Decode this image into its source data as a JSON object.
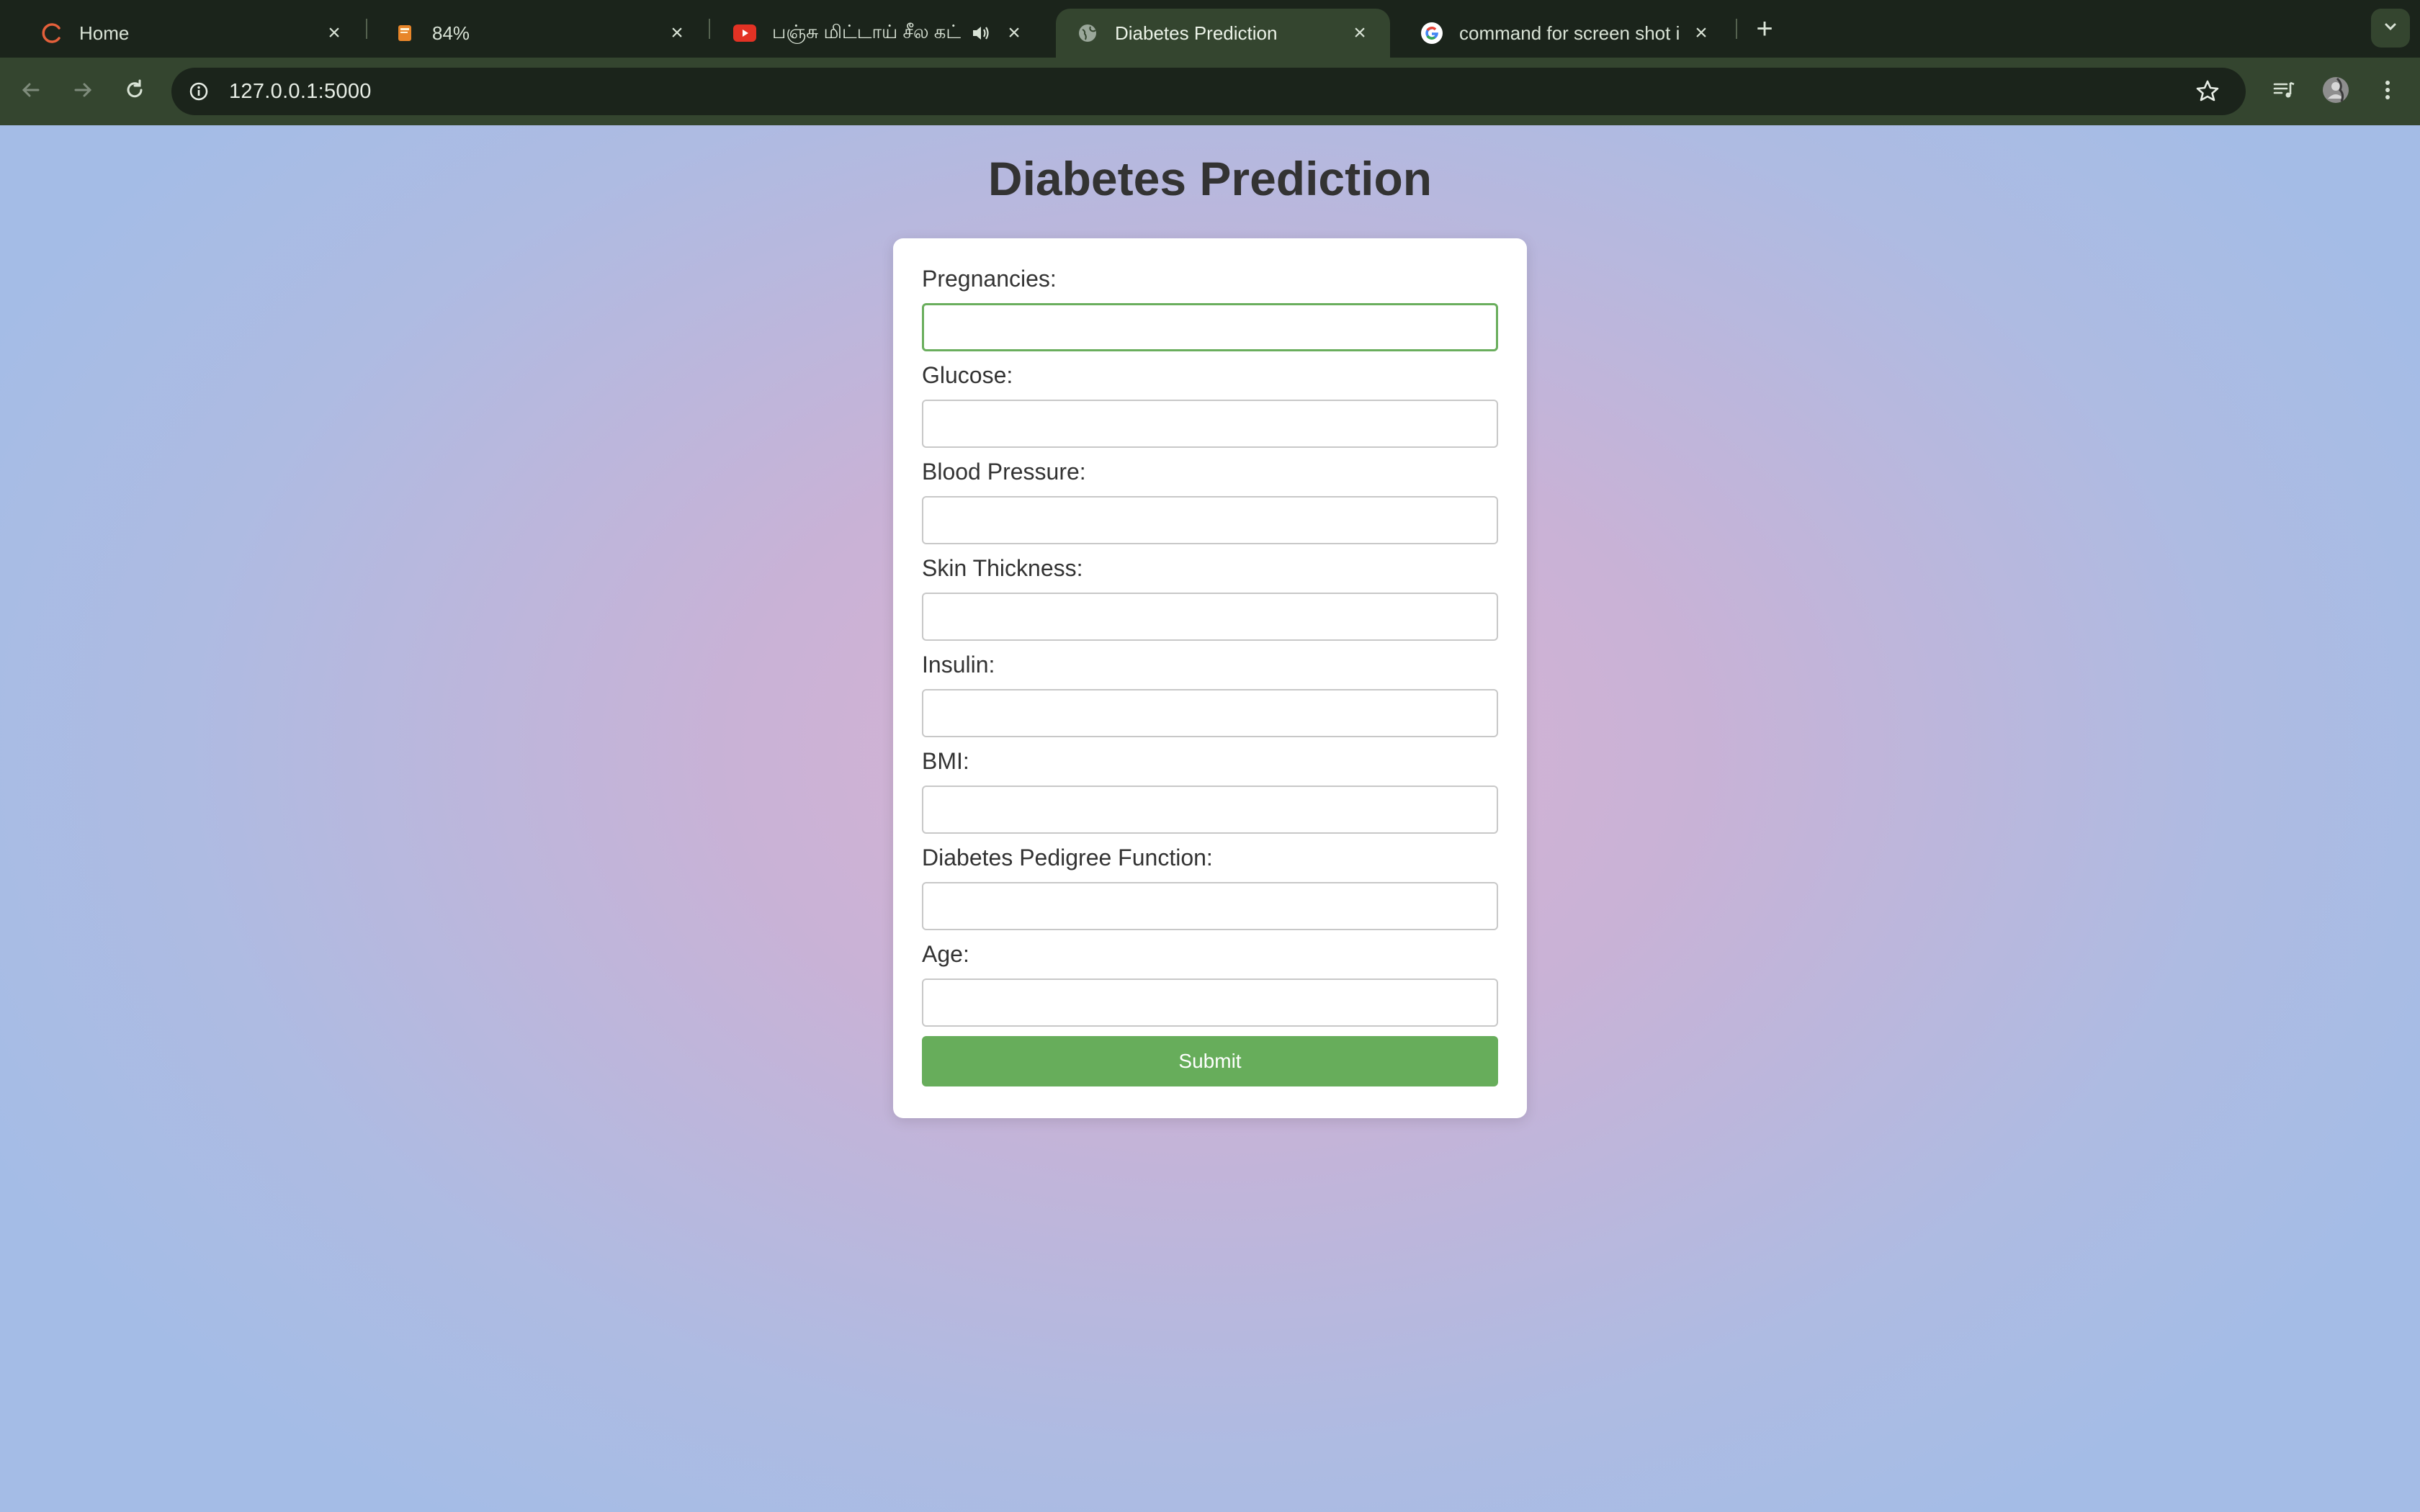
{
  "browser": {
    "tabs": [
      {
        "title": "Home",
        "favicon": "loading-spinner-icon"
      },
      {
        "title": "84%",
        "favicon": "book-icon"
      },
      {
        "title": "பஞ்சு மிட்டாய் சீல கட்டி | ஜ",
        "favicon": "youtube-icon",
        "audio": "speaker-icon"
      },
      {
        "title": "Diabetes Prediction",
        "favicon": "globe-icon",
        "active": true
      },
      {
        "title": "command for screen shot in m",
        "favicon": "google-icon"
      }
    ],
    "new_tab_label": "+",
    "url": "127.0.0.1:5000"
  },
  "page": {
    "title": "Diabetes Prediction",
    "fields": [
      {
        "label": "Pregnancies:",
        "value": ""
      },
      {
        "label": "Glucose:",
        "value": ""
      },
      {
        "label": "Blood Pressure:",
        "value": ""
      },
      {
        "label": "Skin Thickness:",
        "value": ""
      },
      {
        "label": "Insulin:",
        "value": ""
      },
      {
        "label": "BMI:",
        "value": ""
      },
      {
        "label": "Diabetes Pedigree Function:",
        "value": ""
      },
      {
        "label": "Age:",
        "value": ""
      }
    ],
    "submit_label": "Submit"
  },
  "colors": {
    "accent_green": "#67ad5b",
    "browser_frame": "#34452f",
    "tabstrip": "#1b241b"
  }
}
